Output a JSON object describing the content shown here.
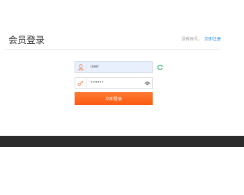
{
  "header": {
    "title": "会员登录",
    "register_prompt": "没有账号，",
    "register_link": "立即注册"
  },
  "form": {
    "username_value": "user",
    "password_value": "•••••••",
    "login_label": "立即登录"
  },
  "icons": {
    "username": "user-icon",
    "password": "key-icon",
    "show_password": "eye-icon",
    "refresh": "refresh-icon"
  },
  "colors": {
    "accent": "#fa5a10",
    "link": "#1e88e5",
    "footer": "#2b2b2b",
    "icon": "#e98a5a",
    "refresh": "#3cb371"
  }
}
